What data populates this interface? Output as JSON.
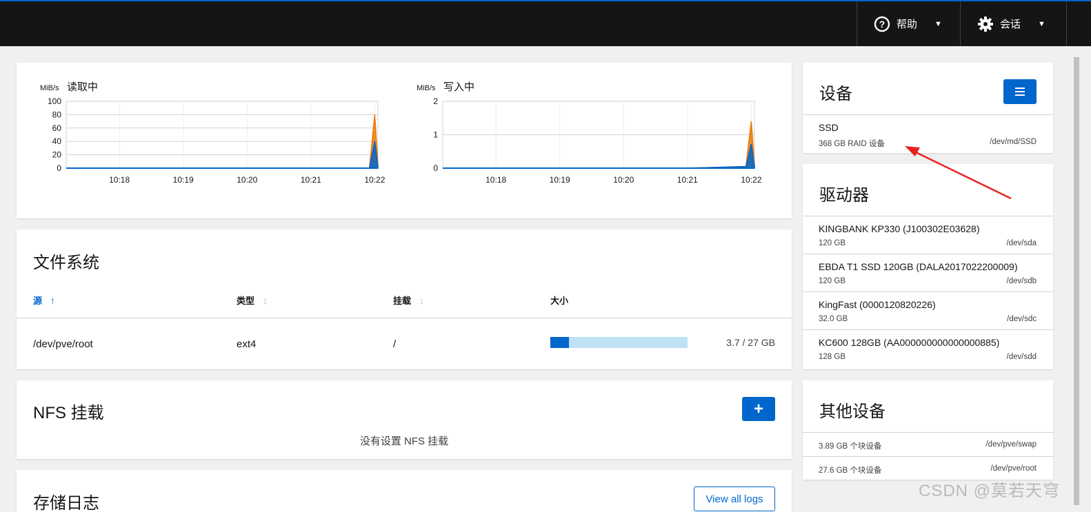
{
  "topbar": {
    "help_label": "帮助",
    "session_label": "会话",
    "accent_color": "#0066cc"
  },
  "charts": {
    "read": {
      "unit": "MiB/s",
      "title": "读取中",
      "yticks": [
        "100",
        "80",
        "60",
        "40",
        "20",
        "0"
      ],
      "xticks": [
        "10:18",
        "10:19",
        "10:20",
        "10:21",
        "10:22"
      ]
    },
    "write": {
      "unit": "MiB/s",
      "title": "写入中",
      "yticks": [
        "2",
        "1",
        "0"
      ],
      "xticks": [
        "10:18",
        "10:19",
        "10:20",
        "10:21",
        "10:22"
      ]
    }
  },
  "chart_data": [
    {
      "type": "area",
      "title": "读取中",
      "ylabel": "MiB/s",
      "ylim": [
        0,
        100
      ],
      "x": [
        "10:17:10",
        "10:18",
        "10:19",
        "10:20",
        "10:21",
        "10:21:55",
        "10:22",
        "10:22:03"
      ],
      "series": [
        {
          "color": "#ec7a08",
          "values": [
            0,
            0,
            0,
            0,
            0,
            0,
            80,
            5
          ]
        },
        {
          "color": "#0066cc",
          "values": [
            0,
            0,
            0,
            0,
            0,
            0,
            40,
            2
          ]
        }
      ]
    },
    {
      "type": "area",
      "title": "写入中",
      "ylabel": "MiB/s",
      "ylim": [
        0,
        2
      ],
      "x": [
        "10:17:10",
        "10:18",
        "10:19",
        "10:20",
        "10:21",
        "10:21:55",
        "10:22",
        "10:22:03"
      ],
      "series": [
        {
          "color": "#ec7a08",
          "values": [
            0,
            0,
            0,
            0,
            0,
            0.05,
            1.4,
            0.1
          ]
        },
        {
          "color": "#0066cc",
          "values": [
            0,
            0,
            0,
            0,
            0,
            0.05,
            0.72,
            0.05
          ]
        }
      ]
    }
  ],
  "filesystems": {
    "title": "文件系统",
    "columns": {
      "source": "源",
      "type": "类型",
      "mount": "挂载",
      "size": "大小"
    },
    "sort_icons": {
      "active": "arrow-up-icon",
      "inactive": "sort-icon"
    },
    "rows": [
      {
        "source": "/dev/pve/root",
        "type": "ext4",
        "mount": "/",
        "usage_fraction": 0.137,
        "size_text": "3.7 / 27 GB"
      }
    ]
  },
  "nfs": {
    "title": "NFS 挂载",
    "add_label": "+",
    "empty_text": "没有设置 NFS 挂载"
  },
  "logs": {
    "title": "存储日志",
    "view_all_label": "View all logs"
  },
  "devices": {
    "title": "设备",
    "menu_icon": "hamburger-icon",
    "items": [
      {
        "name": "SSD",
        "sub": "368 GB RAID 设备",
        "dev": "/dev/md/SSD"
      }
    ]
  },
  "drives": {
    "title": "驱动器",
    "items": [
      {
        "name": "KINGBANK KP330 (J100302E03628)",
        "sub": "120 GB",
        "dev": "/dev/sda"
      },
      {
        "name": "EBDA T1 SSD 120GB (DALA2017022200009)",
        "sub": "120 GB",
        "dev": "/dev/sdb"
      },
      {
        "name": "KingFast (0000120820226)",
        "sub": "32.0 GB",
        "dev": "/dev/sdc"
      },
      {
        "name": "KC600 128GB (AA000000000000000885)",
        "sub": "128 GB",
        "dev": "/dev/sdd"
      }
    ]
  },
  "other_devices": {
    "title": "其他设备",
    "items": [
      {
        "sub": "3.89 GB 个块设备",
        "dev": "/dev/pve/swap"
      },
      {
        "sub": "27.6 GB 个块设备",
        "dev": "/dev/pve/root"
      }
    ]
  },
  "watermark": "CSDN @莫若天穹"
}
